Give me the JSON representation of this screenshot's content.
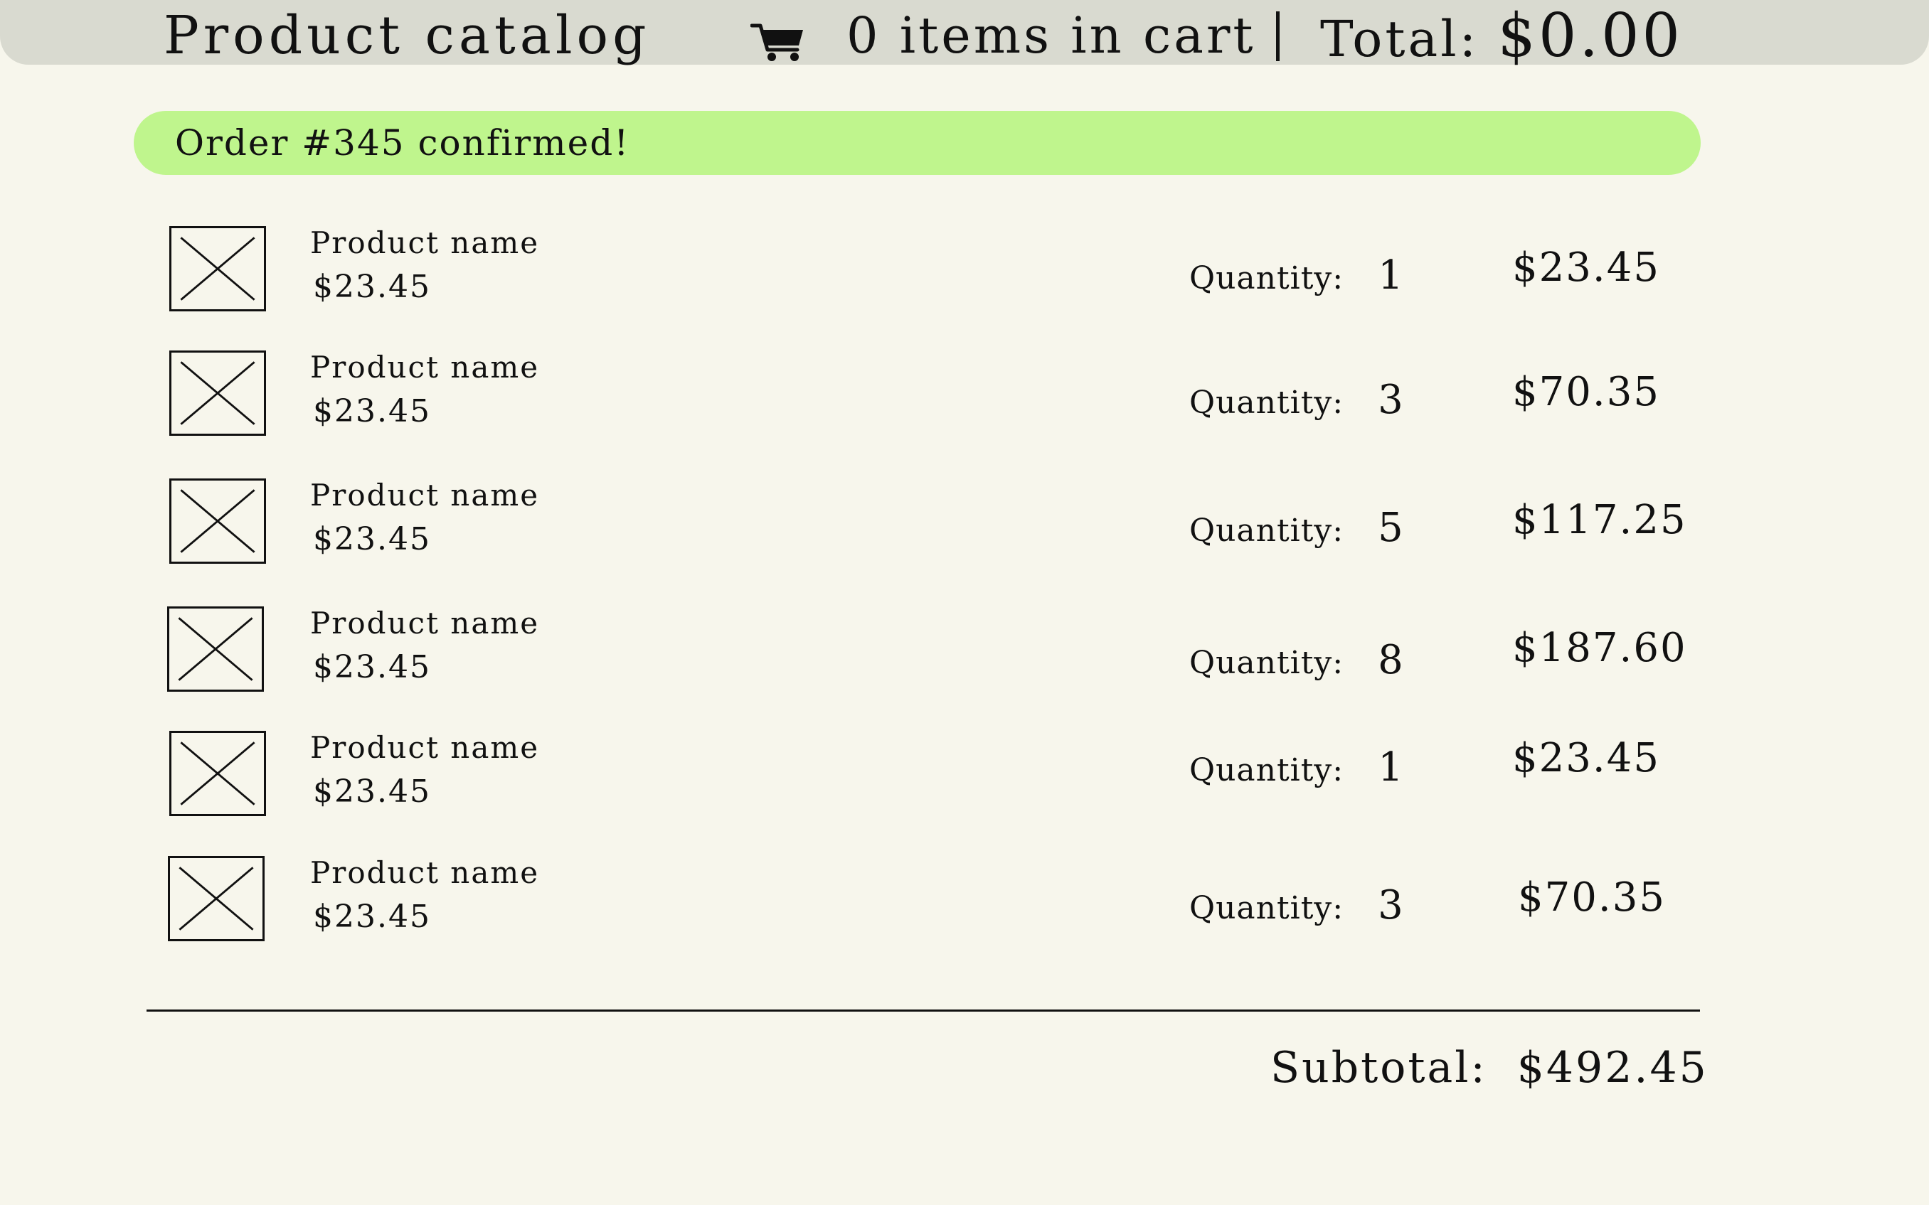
{
  "header": {
    "title": "Product catalog",
    "cart_count_text": "0 items in cart",
    "total_label": "Total:",
    "total_value": "$0.00"
  },
  "banner": {
    "text": "Order #345 confirmed!"
  },
  "items": [
    {
      "name": "Product name",
      "price": "$23.45",
      "quantity_label": "Quantity:",
      "quantity": "1",
      "line_total": "$23.45"
    },
    {
      "name": "Product name",
      "price": "$23.45",
      "quantity_label": "Quantity:",
      "quantity": "3",
      "line_total": "$70.35"
    },
    {
      "name": "Product name",
      "price": "$23.45",
      "quantity_label": "Quantity:",
      "quantity": "5",
      "line_total": "$117.25"
    },
    {
      "name": "Product name",
      "price": "$23.45",
      "quantity_label": "Quantity:",
      "quantity": "8",
      "line_total": "$187.60"
    },
    {
      "name": "Product name",
      "price": "$23.45",
      "quantity_label": "Quantity:",
      "quantity": "1",
      "line_total": "$23.45"
    },
    {
      "name": "Product name",
      "price": "$23.45",
      "quantity_label": "Quantity:",
      "quantity": "3",
      "line_total": "$70.35"
    }
  ],
  "summary": {
    "subtotal_label": "Subtotal:",
    "subtotal_value": "$492.45"
  },
  "icons": {
    "cart": "shopping-cart-icon",
    "thumbnail": "image-placeholder-icon"
  },
  "colors": {
    "background": "#f7f6ec",
    "header_bar": "#d9dad0",
    "banner": "#bff58d",
    "ink": "#111111"
  }
}
